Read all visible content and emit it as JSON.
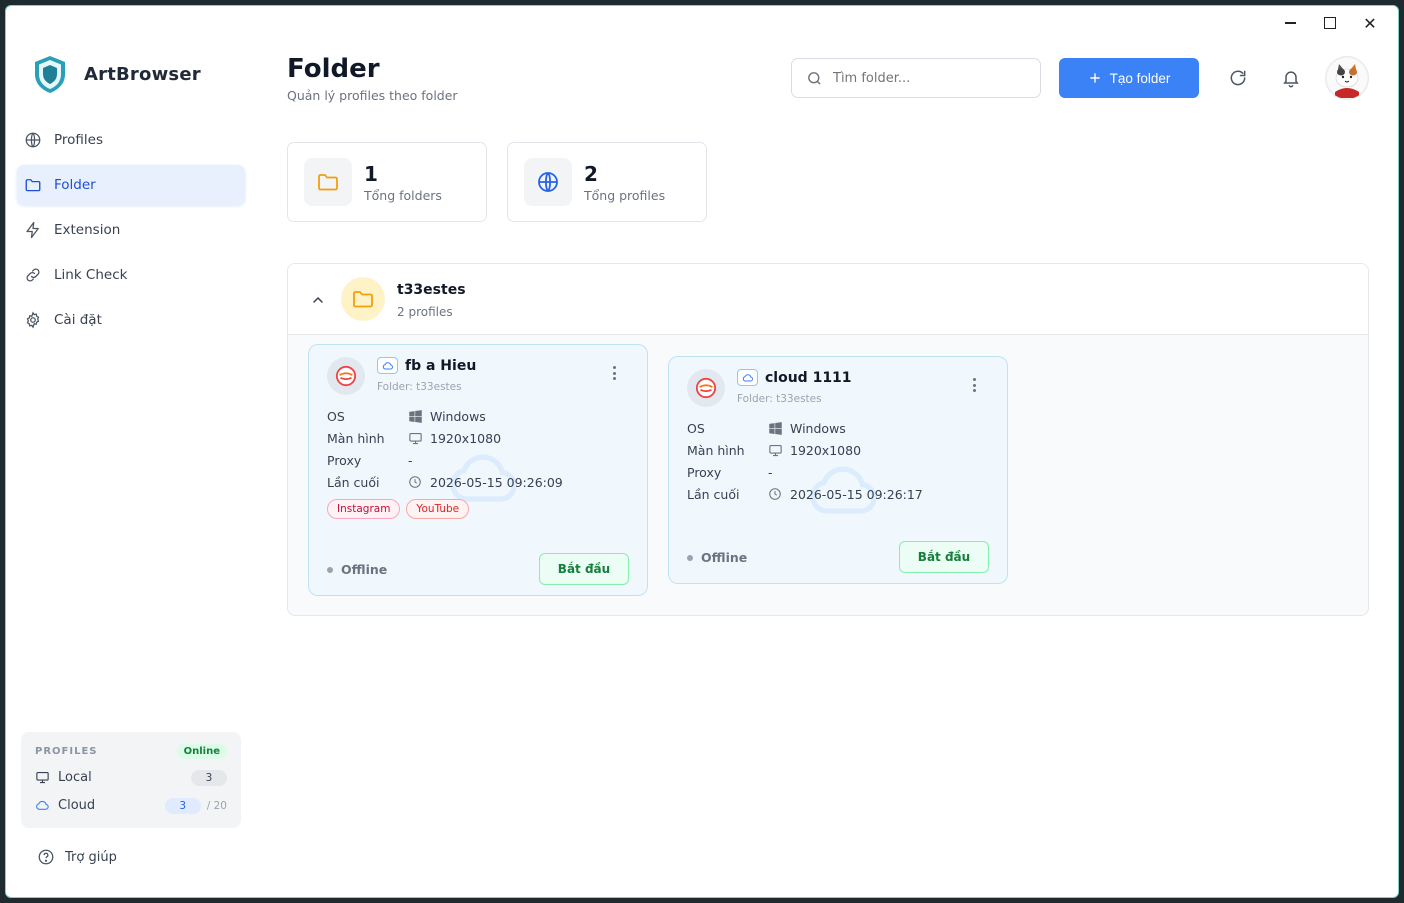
{
  "app": {
    "name": "ArtBrowser"
  },
  "window_controls": {
    "close": "✕"
  },
  "sidebar": {
    "items": [
      {
        "id": "profiles",
        "label": "Profiles",
        "icon": "globe-icon"
      },
      {
        "id": "folder",
        "label": "Folder",
        "icon": "folder-icon",
        "active": true
      },
      {
        "id": "extension",
        "label": "Extension",
        "icon": "lightning-icon"
      },
      {
        "id": "link-check",
        "label": "Link Check",
        "icon": "link-icon"
      },
      {
        "id": "settings",
        "label": "Cài đặt",
        "icon": "gear-icon"
      }
    ],
    "stats": {
      "heading": "PROFILES",
      "status": "Online",
      "local_label": "Local",
      "local_count": "3",
      "cloud_label": "Cloud",
      "cloud_count": "3",
      "cloud_limit": "/ 20"
    },
    "help_label": "Trợ giúp"
  },
  "header": {
    "title": "Folder",
    "subtitle": "Quản lý profiles theo folder",
    "search_placeholder": "Tìm folder...",
    "create_label": "Tạo folder"
  },
  "stat_cards": [
    {
      "value": "1",
      "label": "Tổng folders",
      "icon": "folder-icon"
    },
    {
      "value": "2",
      "label": "Tổng profiles",
      "icon": "globe-icon"
    }
  ],
  "folder": {
    "name": "t33estes",
    "count_label": "2 profiles",
    "profiles": [
      {
        "name": "fb a Hieu",
        "folder_label": "Folder: t33estes",
        "os_label": "OS",
        "os_value": "Windows",
        "screen_label": "Màn hình",
        "screen_value": "1920x1080",
        "proxy_label": "Proxy",
        "proxy_value": "-",
        "last_label": "Lần cuối",
        "last_value": "2026-05-15 09:26:09",
        "tags": [
          "Instagram",
          "YouTube"
        ],
        "status": "Offline",
        "start_label": "Bắt đầu"
      },
      {
        "name": "cloud 1111",
        "folder_label": "Folder: t33estes",
        "os_label": "OS",
        "os_value": "Windows",
        "screen_label": "Màn hình",
        "screen_value": "1920x1080",
        "proxy_label": "Proxy",
        "proxy_value": "-",
        "last_label": "Lần cuối",
        "last_value": "2026-05-15 09:26:17",
        "status": "Offline",
        "start_label": "Bắt đầu"
      }
    ]
  },
  "colors": {
    "accent": "#3b82f6",
    "folder": "#f59e0b",
    "success": "#15803d"
  }
}
